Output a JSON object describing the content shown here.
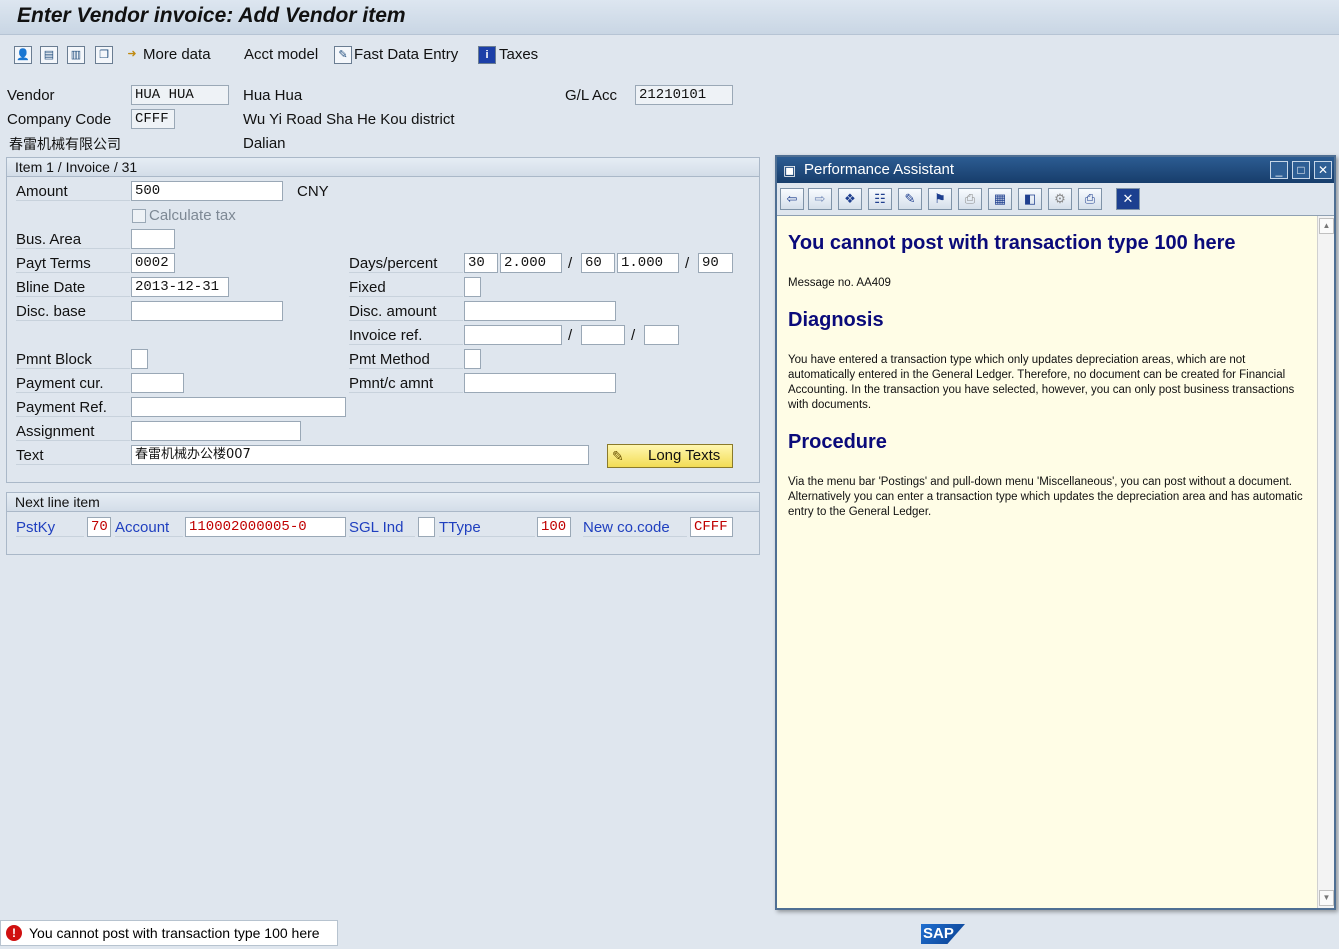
{
  "window": {
    "title": "Enter Vendor invoice: Add Vendor item"
  },
  "toolbar": {
    "more_data": "More data",
    "acct_model": "Acct model",
    "fast_data_entry": "Fast Data Entry",
    "taxes": "Taxes"
  },
  "header": {
    "vendor_label": "Vendor",
    "vendor_value": "HUA HUA",
    "vendor_name": "Hua Hua",
    "company_code_label": "Company Code",
    "company_code_value": "CFFF",
    "company_name": "春雷机械有限公司",
    "street": "Wu Yi Road Sha He Kou district",
    "city": "Dalian",
    "gl_acc_label": "G/L Acc",
    "gl_acc_value": "21210101"
  },
  "item": {
    "heading": "Item 1 / Invoice / 31",
    "amount_label": "Amount",
    "amount_value": "500",
    "currency": "CNY",
    "calculate_tax": "Calculate tax",
    "bus_area_label": "Bus. Area",
    "payt_terms_label": "Payt Terms",
    "payt_terms_value": "0002",
    "bline_date_label": "Bline Date",
    "bline_date_value": "2013-12-31",
    "disc_base_label": "Disc. base",
    "days_percent_label": "Days/percent",
    "days1": "30",
    "pct1": "2.000",
    "days2": "60",
    "pct2": "1.000",
    "days3": "90",
    "slash": "/",
    "fixed_label": "Fixed",
    "disc_amount_label": "Disc. amount",
    "invoice_ref_label": "Invoice ref.",
    "pmnt_block_label": "Pmnt Block",
    "pmt_method_label": "Pmt Method",
    "payment_cur_label": "Payment cur.",
    "pmnt_c_amnt_label": "Pmnt/c amnt",
    "payment_ref_label": "Payment Ref.",
    "assignment_label": "Assignment",
    "text_label": "Text",
    "text_value": "春雷机械办公楼007",
    "long_texts": "Long Texts"
  },
  "next_line": {
    "heading": "Next line item",
    "pstky_label": "PstKy",
    "pstky_value": "70",
    "account_label": "Account",
    "account_value": "110002000005-0",
    "sgl_ind_label": "SGL Ind",
    "ttype_label": "TType",
    "ttype_value": "100",
    "new_co_code_label": "New co.code",
    "new_co_code_value": "CFFF"
  },
  "assistant": {
    "title": "Performance Assistant",
    "heading": "You cannot post with transaction type 100 here",
    "message_no": "Message no. AA409",
    "diagnosis_heading": "Diagnosis",
    "diagnosis_text": "You have entered a transaction type which only updates depreciation areas, which are not automatically entered in the General Ledger. Therefore, no document can be created for Financial Accounting. In the transaction you have selected, however, you can only post business transactions with documents.",
    "procedure_heading": "Procedure",
    "procedure_text": "Via the menu bar 'Postings' and pull-down menu 'Miscellaneous', you can post without a document. Alternatively you can enter a transaction type which updates the depreciation area and has automatic entry to the General Ledger."
  },
  "status_bar": {
    "message": "You cannot post with transaction type 100 here",
    "brand": "SAP"
  },
  "colors": {
    "title_blue": "#173d6b",
    "error_red": "#c00000",
    "heading_navy": "#0a0a7a"
  }
}
